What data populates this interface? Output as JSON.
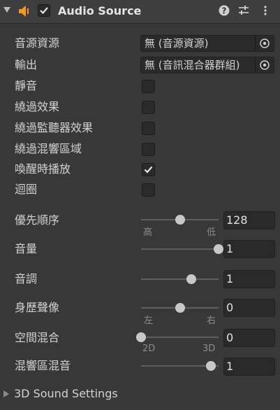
{
  "header": {
    "title": "Audio Source",
    "enabled": true,
    "icons": [
      "speaker-icon",
      "help-icon",
      "presets-icon",
      "more-icon"
    ]
  },
  "fields": {
    "audio_clip": {
      "label": "音源資源",
      "value": "無 (音源資源)"
    },
    "output": {
      "label": "輸出",
      "value": "無 (音訊混合器群組)"
    },
    "mute": {
      "label": "靜音",
      "checked": false
    },
    "bypass_effects": {
      "label": "繞過效果",
      "checked": false
    },
    "bypass_listener_effects": {
      "label": "繞過監聽器效果",
      "checked": false
    },
    "bypass_reverb_zones": {
      "label": "繞過混響區域",
      "checked": false
    },
    "play_on_awake": {
      "label": "喚醒時播放",
      "checked": true
    },
    "loop": {
      "label": "迴圈",
      "checked": false
    }
  },
  "sliders": {
    "priority": {
      "label": "優先順序",
      "value": "128",
      "fraction": 0.5,
      "min_label": "高",
      "max_label": "低"
    },
    "volume": {
      "label": "音量",
      "value": "1",
      "fraction": 1.0
    },
    "pitch": {
      "label": "音調",
      "value": "1",
      "fraction": 0.645
    },
    "stereo_pan": {
      "label": "身歷聲像",
      "value": "0",
      "fraction": 0.5,
      "min_label": "左",
      "max_label": "右"
    },
    "spatial_blend": {
      "label": "空間混合",
      "value": "0",
      "fraction": 0.0,
      "min_label": "2D",
      "max_label": "3D"
    },
    "reverb_zone_mix": {
      "label": "混響區混音",
      "value": "1",
      "fraction": 0.9
    }
  },
  "footer": {
    "label": "3D Sound Settings",
    "expanded": false
  },
  "colors": {
    "background": "#383838",
    "field": "#2a2a2a",
    "accent": "#f39a1e",
    "thumb": "#c8c8c8"
  }
}
